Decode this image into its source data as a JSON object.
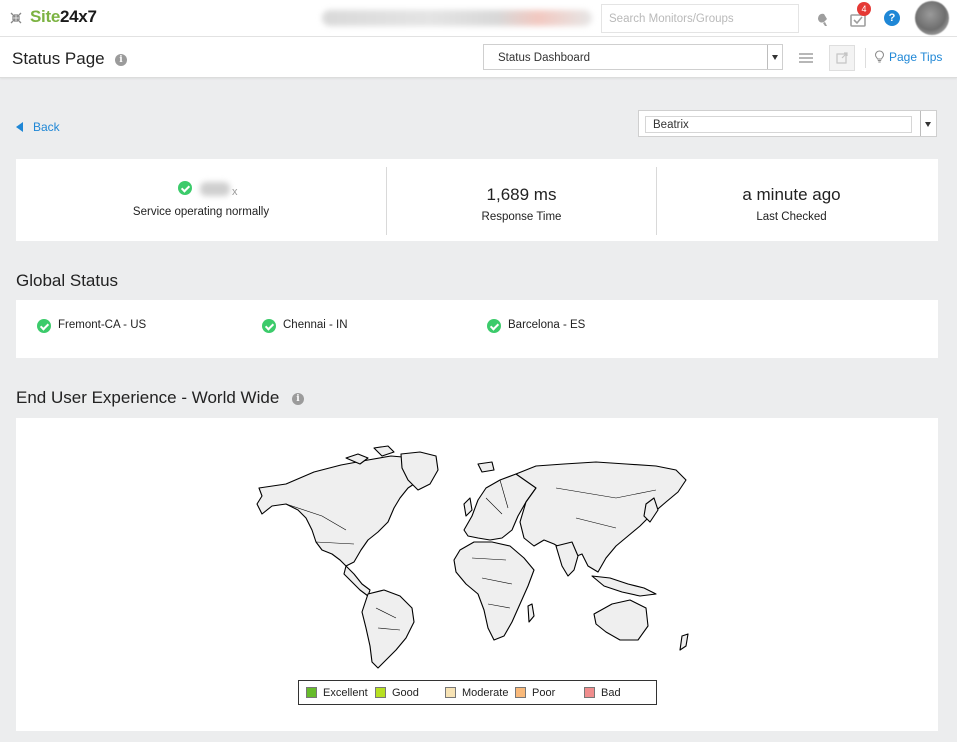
{
  "app": {
    "logo_site": "Site",
    "logo_num": "24x7"
  },
  "search": {
    "placeholder": "Search Monitors/Groups"
  },
  "notifications": {
    "count": "4"
  },
  "help": {
    "label": "?"
  },
  "subheader": {
    "title": "Status Page",
    "dashboard_select": "Status Dashboard",
    "page_tips": "Page Tips"
  },
  "content": {
    "back_label": "Back",
    "monitor_select": "Beatrix"
  },
  "summary": {
    "name_suffix": "x",
    "status_text": "Service operating normally",
    "response_value": "1,689 ms",
    "response_label": "Response Time",
    "checked_value": "a minute ago",
    "checked_label": "Last Checked"
  },
  "global_status": {
    "title": "Global Status",
    "locations": [
      {
        "name": "Fremont-CA - US",
        "status": "up"
      },
      {
        "name": "Chennai - IN",
        "status": "up"
      },
      {
        "name": "Barcelona - ES",
        "status": "up"
      }
    ]
  },
  "experience": {
    "title": "End User Experience - World Wide",
    "legend": [
      {
        "label": "Excellent",
        "color": "#66bb2a"
      },
      {
        "label": "Good",
        "color": "#b7e021"
      },
      {
        "label": "Moderate",
        "color": "#f7e3b5"
      },
      {
        "label": "Poor",
        "color": "#f9b97a"
      },
      {
        "label": "Bad",
        "color": "#f08d8d"
      }
    ]
  },
  "colors": {
    "accent": "#1f87d6",
    "ok": "#3ccb6b",
    "badge": "#e53935",
    "logo_green": "#7cb342"
  }
}
